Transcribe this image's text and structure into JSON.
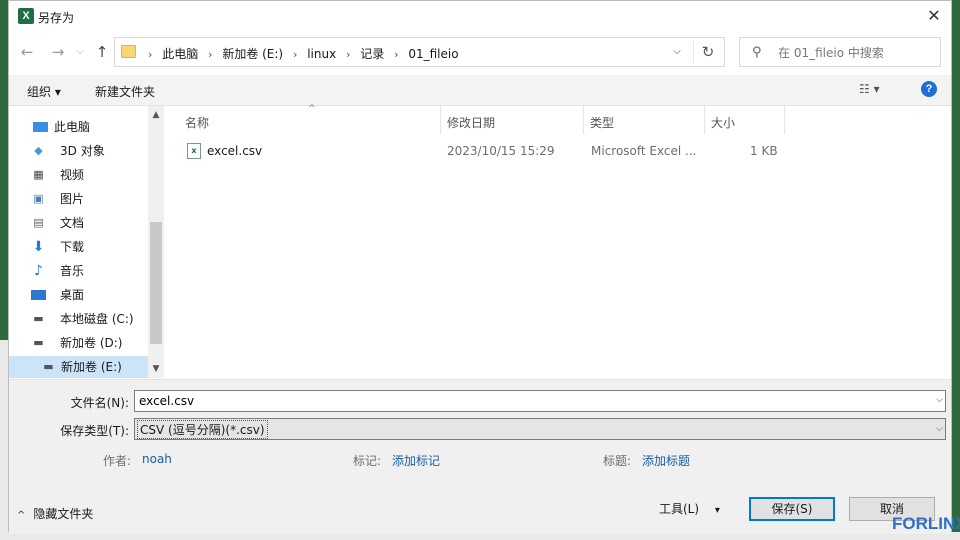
{
  "window": {
    "app_icon": "X",
    "title": "另存为",
    "close_glyph": "✕"
  },
  "nav": {
    "back_glyph": "←",
    "forward_glyph": "→",
    "recent_glyph": "⌵",
    "up_glyph": "↑"
  },
  "address": {
    "crumbs": [
      "此电脑",
      "新加卷 (E:)",
      "linux",
      "记录",
      "01_fileio"
    ],
    "separator": "›",
    "dropdown_glyph": "⌵",
    "refresh_glyph": "↻"
  },
  "search": {
    "icon": "⚲",
    "placeholder": "在 01_fileio 中搜索"
  },
  "toolbar": {
    "organize_label": "组织 ▾",
    "new_folder_label": "新建文件夹",
    "view_glyph": "☷ ▾",
    "help_glyph": "?"
  },
  "sidebar": {
    "items": [
      {
        "label": "此电脑",
        "icon": "computer-icon"
      },
      {
        "label": "3D 对象",
        "icon": "3d-objects-icon"
      },
      {
        "label": "视频",
        "icon": "video-icon"
      },
      {
        "label": "图片",
        "icon": "pictures-icon"
      },
      {
        "label": "文档",
        "icon": "documents-icon"
      },
      {
        "label": "下载",
        "icon": "download-icon"
      },
      {
        "label": "音乐",
        "icon": "music-icon"
      },
      {
        "label": "桌面",
        "icon": "desktop-icon"
      },
      {
        "label": "本地磁盘 (C:)",
        "icon": "drive-icon"
      },
      {
        "label": "新加卷 (D:)",
        "icon": "drive-icon"
      },
      {
        "label": "新加卷 (E:)",
        "icon": "drive-icon",
        "selected": true
      }
    ],
    "scroll_up": "▲",
    "scroll_down": "▼"
  },
  "filelist": {
    "sort_glyph": "^",
    "columns": [
      "名称",
      "修改日期",
      "类型",
      "大小"
    ],
    "rows": [
      {
        "name": "excel.csv",
        "modified": "2023/10/15 15:29",
        "type": "Microsoft Excel ...",
        "size": "1 KB"
      }
    ]
  },
  "form": {
    "filename_label": "文件名(N):",
    "filename_value": "excel.csv",
    "filetype_label": "保存类型(T):",
    "filetype_value": "CSV (逗号分隔)(*.csv)",
    "author_label": "作者:",
    "author_value": "noah",
    "tags_label": "标记:",
    "tags_value": "添加标记",
    "title_label": "标题:",
    "title_value": "添加标题",
    "dropdown_glyph": "⌵"
  },
  "footer": {
    "hide_folders_label": "隐藏文件夹",
    "hide_folders_chevron": "^",
    "tools_label": "工具(L)",
    "tools_arrow": "▾",
    "save_label": "保存(S)",
    "cancel_label": "取消"
  },
  "watermark": "FORLINX",
  "colors": {
    "accent": "#0078d7",
    "selection": "#cce4f7",
    "excel_green": "#1d6f42",
    "link": "#1a5ea8"
  }
}
